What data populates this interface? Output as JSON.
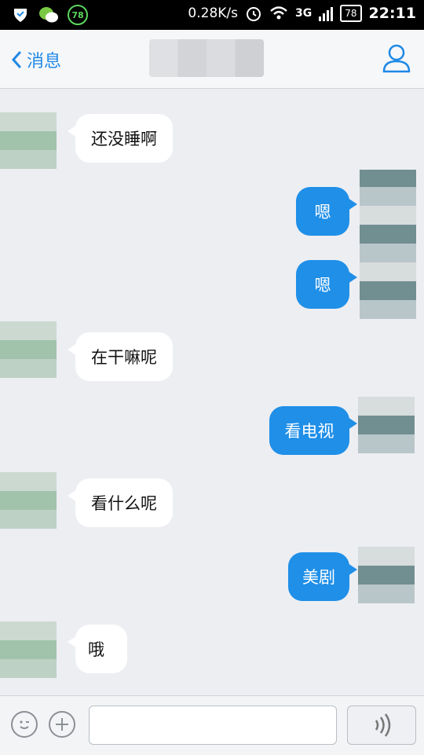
{
  "status_bar": {
    "speed": "0.28K/s",
    "network": "3G",
    "battery": "78",
    "badge": "78",
    "time": "22:11"
  },
  "header": {
    "back_label": "消息",
    "contact_name": ""
  },
  "messages": [
    {
      "side": "in",
      "text": "还没睡啊"
    },
    {
      "side": "out",
      "text": "嗯"
    },
    {
      "side": "out",
      "text": "嗯"
    },
    {
      "side": "in",
      "text": "在干嘛呢"
    },
    {
      "side": "out",
      "text": "看电视"
    },
    {
      "side": "in",
      "text": "看什么呢"
    },
    {
      "side": "out",
      "text": "美剧"
    },
    {
      "side": "in",
      "text": "哦"
    }
  ],
  "input_bar": {
    "emoji_icon": "emoji-icon",
    "plus_icon": "plus-icon",
    "voice_icon": "voice-icon",
    "message_value": ""
  },
  "colors": {
    "accent": "#1f8fe8",
    "background": "#eceef2"
  }
}
